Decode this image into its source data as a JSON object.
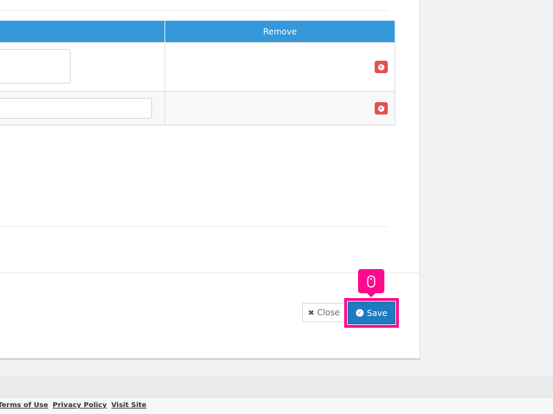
{
  "table": {
    "headers": [
      "",
      "Remove"
    ],
    "rows": [
      {
        "field_value": "",
        "remove_icon": "remove-icon"
      },
      {
        "field_value": "",
        "remove_icon": "remove-icon"
      }
    ]
  },
  "actions": {
    "close_label": "Close",
    "close_icon": "times-icon",
    "save_label": "Save",
    "save_icon": "check-circle-icon"
  },
  "overlay": {
    "cursor_icon": "mouse-icon",
    "highlight_color": "#ff0a8c"
  },
  "footer": {
    "links": [
      "Terms of Use",
      "Privacy Policy",
      "Visit Site"
    ]
  },
  "colors": {
    "header_blue": "#3498db",
    "save_blue": "#1f7bbf",
    "remove_red": "#e05252"
  }
}
